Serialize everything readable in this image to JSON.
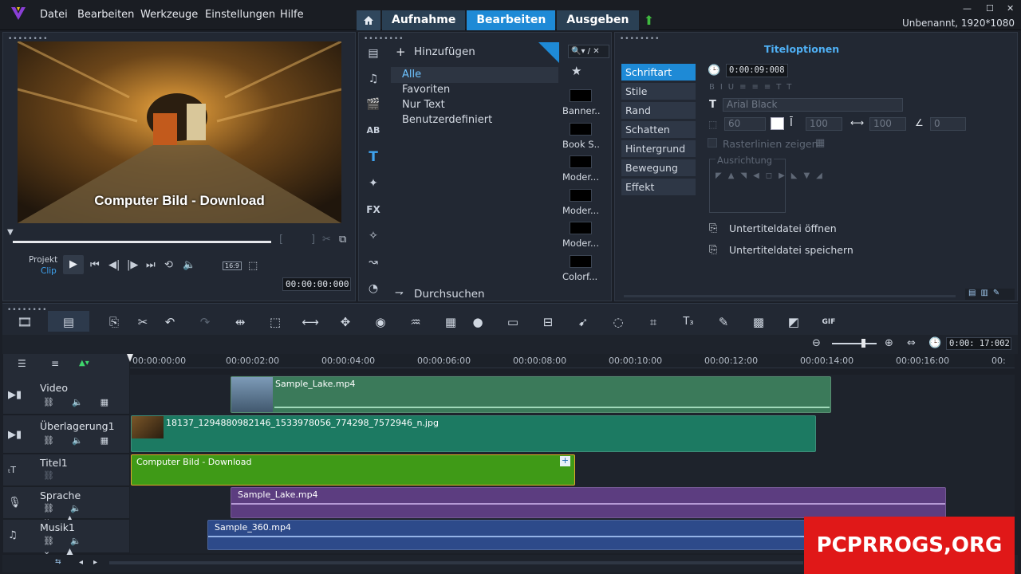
{
  "menubar": {
    "items": [
      "Datei",
      "Bearbeiten",
      "Werkzeuge",
      "Einstellungen",
      "Hilfe"
    ],
    "tabs": [
      "Aufnahme",
      "Bearbeiten",
      "Ausgeben"
    ],
    "active_tab": "Bearbeiten",
    "project_title": "Unbenannt, 1920*1080"
  },
  "preview": {
    "caption": "Computer Bild - Download",
    "mode_project": "Projekt",
    "mode_clip": "Clip",
    "timecode": "00:00:00:000",
    "aspect": "16:9"
  },
  "library": {
    "add_label": "Hinzufügen",
    "categories": [
      "Alle",
      "Favoriten",
      "Nur Text",
      "Benutzerdefiniert"
    ],
    "browse_label": "Durchsuchen",
    "thumbnails": [
      "Banner...",
      "Book S...",
      "Moder...",
      "Moder...",
      "Moder...",
      "Colorf..."
    ]
  },
  "options": {
    "title": "Titeloptionen",
    "tabs": [
      "Schriftart",
      "Stile",
      "Rand",
      "Schatten",
      "Hintergrund",
      "Bewegung",
      "Effekt"
    ],
    "duration": "0:00:09:008",
    "font": "Arial Black",
    "font_size": "60",
    "scale1": "100",
    "scale2": "100",
    "angle": "0",
    "gridlines_label": "Rasterlinien zeigen",
    "alignment_label": "Ausrichtung",
    "open_subtitle": "Untertiteldatei öffnen",
    "save_subtitle": "Untertiteldatei speichern"
  },
  "timeline": {
    "timecode": "0:00: 17:002",
    "ruler": [
      "00:00:00:00",
      "00:00:02:00",
      "00:00:04:00",
      "00:00:06:00",
      "00:00:08:00",
      "00:00:10:00",
      "00:00:12:00",
      "00:00:14:00",
      "00:00:16:00",
      "00:"
    ],
    "tracks": [
      "Video",
      "Überlagerung1",
      "Titel1",
      "Sprache",
      "Musik1"
    ],
    "clips": {
      "video": "Sample_Lake.mp4",
      "overlay": "18137_1294880982146_1533978056_774298_7572946_n.jpg",
      "title": "Computer Bild - Download",
      "voice": "Sample_Lake.mp4",
      "music": "Sample_360.mp4"
    }
  },
  "watermark": "PCPRROGS,ORG",
  "colors": {
    "accent": "#1e8ad6",
    "title_clip": "#3f9a17",
    "video_clip": "#3b7a5a",
    "overlay_clip": "#1c7a62",
    "voice_clip": "#5c3d80",
    "music_clip": "#2d4a8a"
  }
}
